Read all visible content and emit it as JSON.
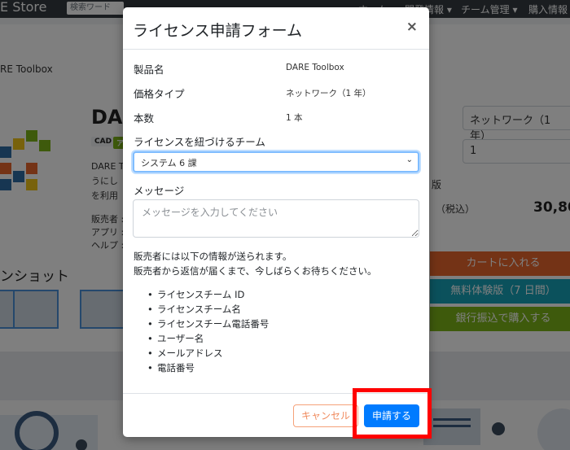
{
  "background": {
    "brand": "E Store",
    "search_placeholder": "検索ワード",
    "nav": [
      "ホーム ▾",
      "開発情報 ▾",
      "チーム管理 ▾",
      "購入情報"
    ],
    "breadcrumb": "RE Toolbox",
    "product_title": "DAF",
    "tags": [
      "CAD",
      "ア"
    ],
    "desc_lines": [
      "DARE To",
      "うにし",
      "を利用"
    ],
    "meta_lines": [
      "販売者 :",
      "アプリ :",
      "ヘルプ :"
    ],
    "screenshot_title": "ンショット",
    "right_select": "ネットワーク（1 年）",
    "right_qty": "1",
    "right_text_1": "版",
    "right_text_2": "（税込）",
    "price": "30,80",
    "btn_cart": "カートに入れる",
    "btn_trial": "無料体験版（7 日間）",
    "btn_bank": "銀行振込で購入する",
    "colors": {
      "cart": "#e8672d",
      "trial": "#17a2b8",
      "bank": "#7cb518"
    }
  },
  "modal": {
    "title": "ライセンス申請フォーム",
    "close_icon": "×",
    "fields": [
      {
        "label": "製品名",
        "value": "DARE Toolbox"
      },
      {
        "label": "価格タイプ",
        "value": "ネットワーク（1 年）"
      },
      {
        "label": "本数",
        "value": "1 本"
      }
    ],
    "team_label": "ライセンスを紐づけるチーム",
    "team_selected": "システム 6 課",
    "message_label": "メッセージ",
    "message_placeholder": "メッセージを入力してください",
    "notice_lines": [
      "販売者には以下の情報が送られます。",
      "販売者から返信が届くまで、今しばらくお待ちください。"
    ],
    "info_items": [
      "ライセンスチーム ID",
      "ライセンスチーム名",
      "ライセンスチーム電話番号",
      "ユーザー名",
      "メールアドレス",
      "電話番号"
    ],
    "cancel_label": "キャンセル",
    "submit_label": "申請する"
  }
}
